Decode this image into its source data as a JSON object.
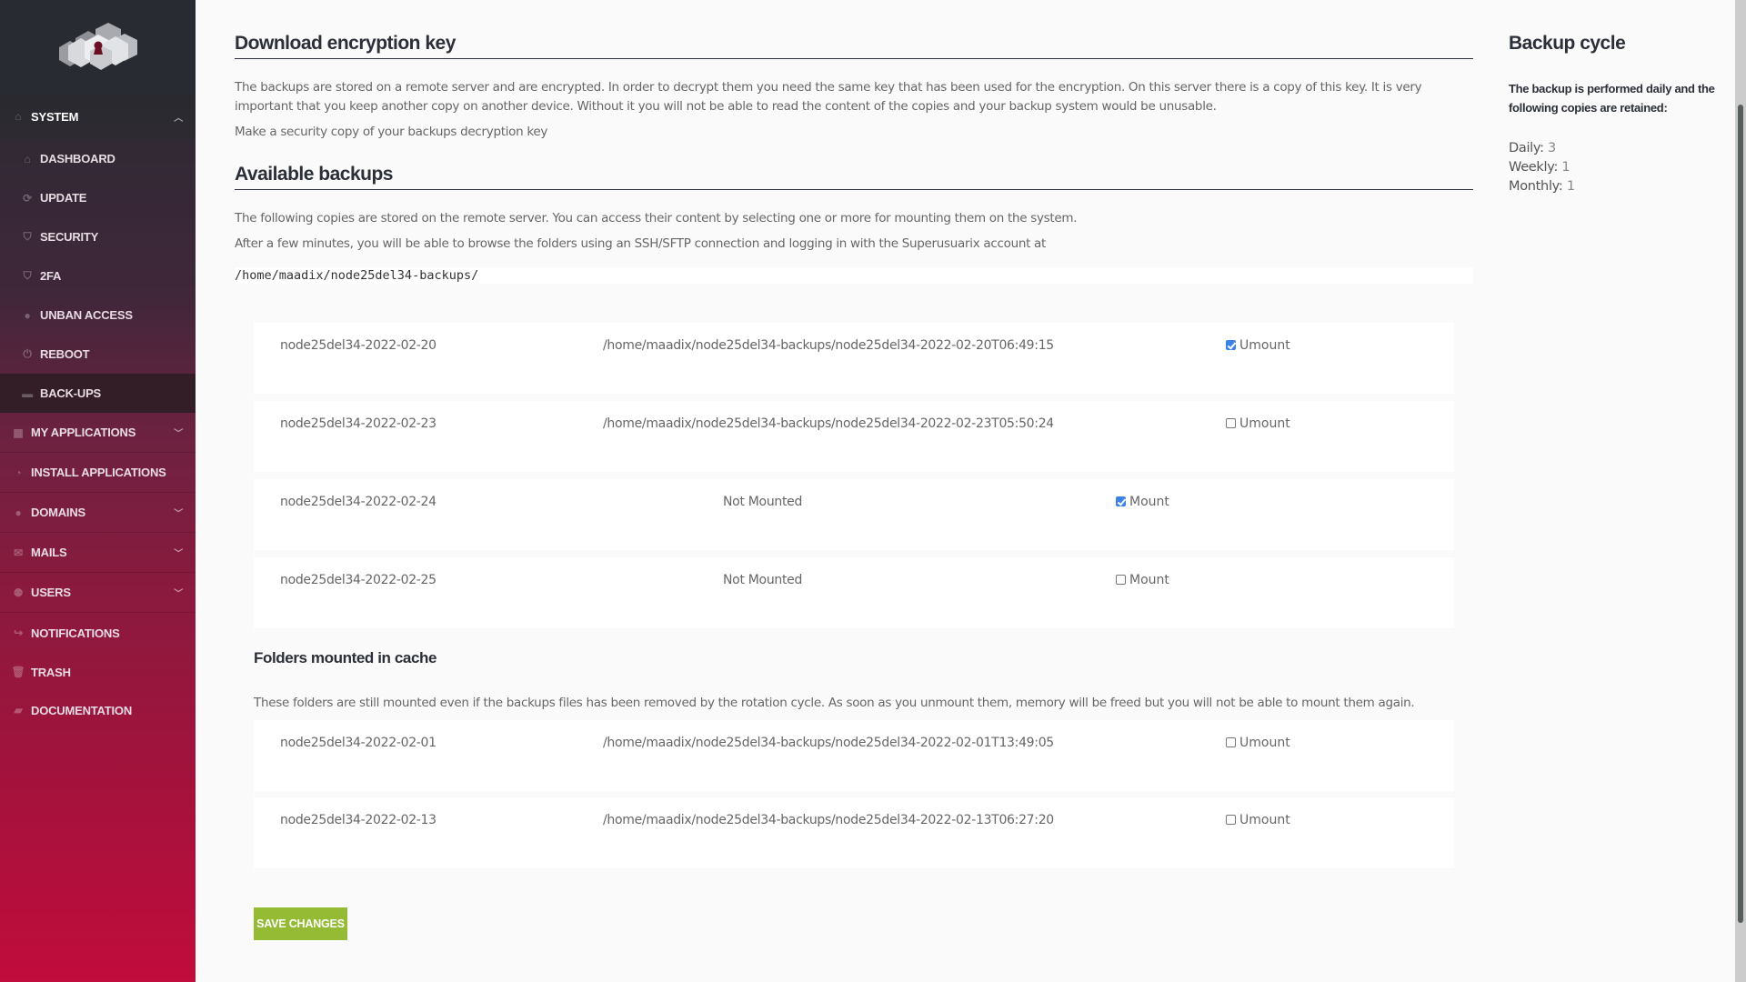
{
  "sidebar": {
    "logo_alt": "cloud-keyhole-logo",
    "system": {
      "label": "SYSTEM",
      "icon": "home-icon",
      "expanded": true
    },
    "system_items": [
      {
        "label": "DASHBOARD",
        "icon": "home-icon",
        "active": false
      },
      {
        "label": "UPDATE",
        "icon": "refresh-icon",
        "active": false
      },
      {
        "label": "SECURITY",
        "icon": "shield-icon",
        "active": false
      },
      {
        "label": "2FA",
        "icon": "shield-icon",
        "active": false
      },
      {
        "label": "UNBAN ACCESS",
        "icon": "user-icon",
        "active": false
      },
      {
        "label": "REBOOT",
        "icon": "power-icon",
        "active": false
      },
      {
        "label": "BACK-UPS",
        "icon": "folder-icon",
        "active": true
      }
    ],
    "items": [
      {
        "label": "MY APPLICATIONS",
        "icon": "grid-icon",
        "chevron": true
      },
      {
        "label": "INSTALL APPLICATIONS",
        "icon": "dashboard-icon",
        "chevron": false
      },
      {
        "label": "DOMAINS",
        "icon": "globe-icon",
        "chevron": true
      },
      {
        "label": "MAILS",
        "icon": "envelope-icon",
        "chevron": true
      },
      {
        "label": "USERS",
        "icon": "users-icon",
        "chevron": true
      },
      {
        "label": "NOTIFICATIONS",
        "icon": "share-icon",
        "chevron": false
      },
      {
        "label": "TRASH",
        "icon": "trash-icon",
        "chevron": false
      },
      {
        "label": "DOCUMENTATION",
        "icon": "book-icon",
        "chevron": false
      }
    ]
  },
  "main": {
    "encryption": {
      "title": "Download encryption key",
      "description": "The backups are stored on a remote server and are encrypted. In order to decrypt them you need the same key that has been used for the encryption. On this server there is a copy of this key. It is very important that you keep another copy on another device. Without it you will not be able to read the content of the copies and your backup system would be unusable.",
      "link_text": "Make a security copy of your backups decryption key"
    },
    "available": {
      "title": "Available backups",
      "description1": "The following copies are stored on the remote server. You can access their content by selecting one or more for mounting them on the system.",
      "description2": "After a few minutes, you will be able to browse the folders using an SSH/SFTP connection and logging in with the Superusuarix account at",
      "path": "/home/maadix/node25del34-backups/",
      "backups": [
        {
          "name": "node25del34-2022-02-20",
          "status": "/home/maadix/node25del34-backups/node25del34-2022-02-20T06:49:15",
          "action": "Umount",
          "checked": true,
          "mounted": true
        },
        {
          "name": "node25del34-2022-02-23",
          "status": "/home/maadix/node25del34-backups/node25del34-2022-02-23T05:50:24",
          "action": "Umount",
          "checked": false,
          "mounted": true
        },
        {
          "name": "node25del34-2022-02-24",
          "status": "Not Mounted",
          "action": "Mount",
          "checked": true,
          "mounted": false
        },
        {
          "name": "node25del34-2022-02-25",
          "status": "Not Mounted",
          "action": "Mount",
          "checked": false,
          "mounted": false
        }
      ]
    },
    "cache": {
      "title": "Folders mounted in cache",
      "description": "These folders are still mounted even if the backups files has been removed by the rotation cycle. As soon as you unmount them, memory will be freed but you will not be able to mount them again.",
      "folders": [
        {
          "name": "node25del34-2022-02-01",
          "status": "/home/maadix/node25del34-backups/node25del34-2022-02-01T13:49:05",
          "action": "Umount",
          "checked": false
        },
        {
          "name": "node25del34-2022-02-13",
          "status": "/home/maadix/node25del34-backups/node25del34-2022-02-13T06:27:20",
          "action": "Umount",
          "checked": false
        }
      ]
    },
    "save_label": "SAVE CHANGES"
  },
  "aside": {
    "title": "Backup cycle",
    "lead": "The backup is performed daily and the following copies are retained:",
    "retention": [
      {
        "label": "Daily:",
        "value": "3"
      },
      {
        "label": "Weekly:",
        "value": "1"
      },
      {
        "label": "Monthly:",
        "value": "1"
      }
    ]
  },
  "colors": {
    "accent_green": "#95bb35",
    "checkbox_blue": "#3c82e6",
    "sidebar_top": "#292b33",
    "sidebar_bottom": "#c10c3c"
  }
}
